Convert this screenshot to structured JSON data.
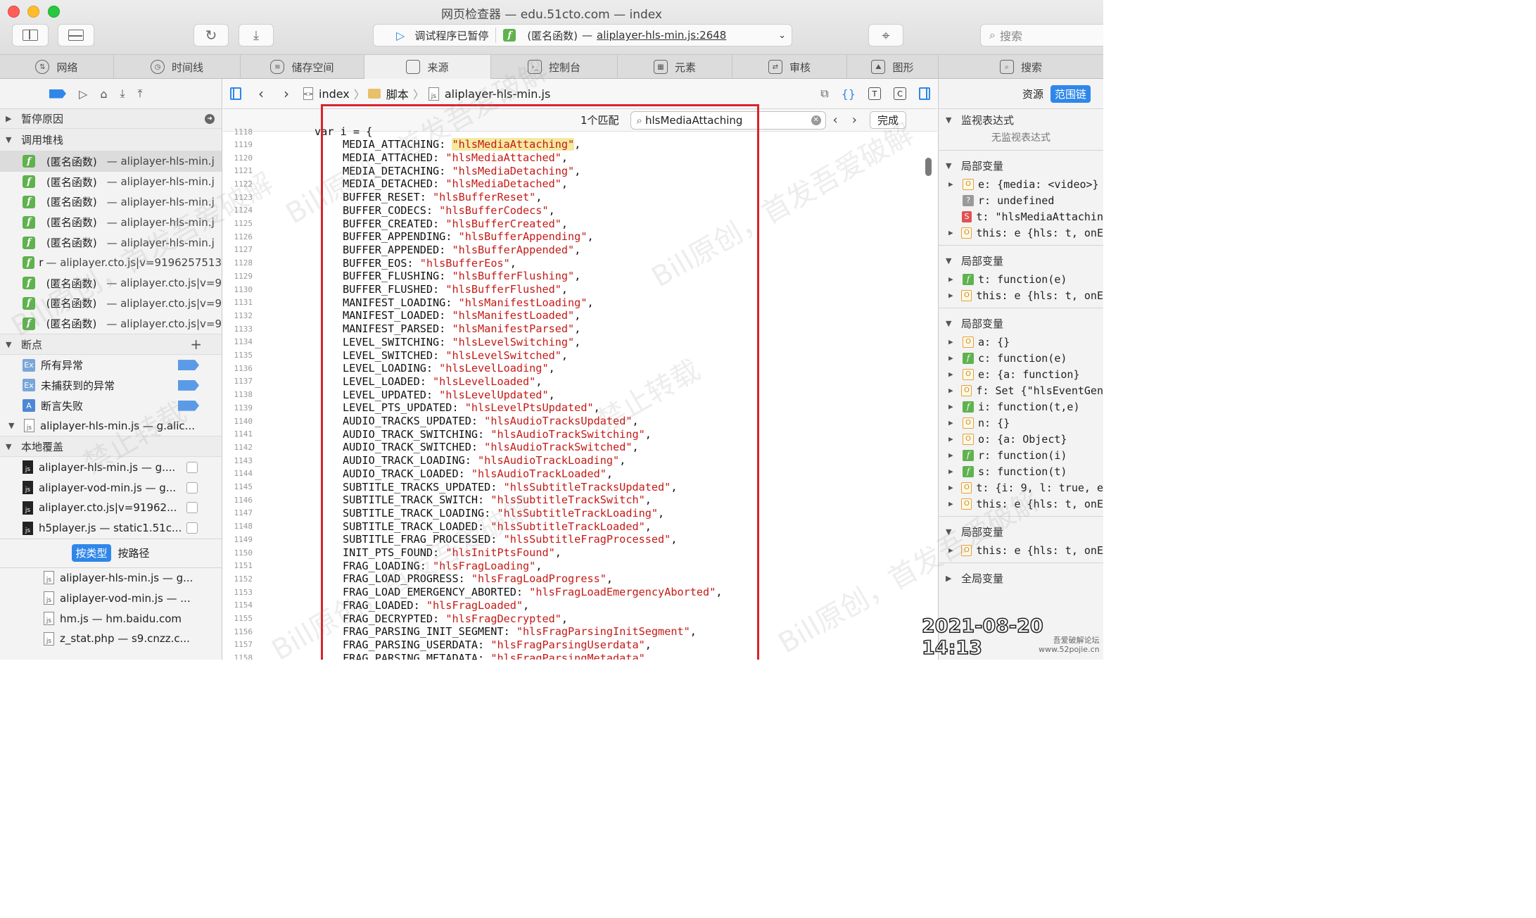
{
  "window": {
    "title": "网页检查器 — edu.51cto.com — index"
  },
  "status": {
    "paused_label": "调试程序已暂停",
    "function_label": "(匿名函数)",
    "location": "aliplayer-hls-min.js:2648"
  },
  "search": {
    "placeholder": "搜索"
  },
  "tabs": [
    {
      "label": "网络"
    },
    {
      "label": "时间线"
    },
    {
      "label": "储存空间"
    },
    {
      "label": "来源"
    },
    {
      "label": "控制台"
    },
    {
      "label": "元素"
    },
    {
      "label": "审核"
    },
    {
      "label": "图形"
    },
    {
      "label": "搜索"
    }
  ],
  "left": {
    "pause_reason": "暂停原因",
    "call_stack": "调用堆栈",
    "frames": [
      {
        "fn": "(匿名函数)",
        "loc": "— aliplayer-hls-min.j"
      },
      {
        "fn": "(匿名函数)",
        "loc": "— aliplayer-hls-min.j"
      },
      {
        "fn": "(匿名函数)",
        "loc": "— aliplayer-hls-min.j"
      },
      {
        "fn": "(匿名函数)",
        "loc": "— aliplayer-hls-min.j"
      },
      {
        "fn": "(匿名函数)",
        "loc": "— aliplayer-hls-min.j"
      },
      {
        "fn": "r",
        "loc": "— aliplayer.cto.js|v=9196257513"
      },
      {
        "fn": "(匿名函数)",
        "loc": "— aliplayer.cto.js|v=9"
      },
      {
        "fn": "(匿名函数)",
        "loc": "— aliplayer.cto.js|v=9"
      },
      {
        "fn": "(匿名函数)",
        "loc": "— aliplayer.cto.js|v=9"
      }
    ],
    "breakpoints": "断点",
    "bp_items": [
      {
        "badge": "Ex",
        "label": "所有异常"
      },
      {
        "badge": "Ex",
        "label": "未捕获到的异常"
      },
      {
        "badge": "A",
        "label": "断言失败"
      }
    ],
    "bp_file": "aliplayer-hls-min.js — g.alic...",
    "local_overrides": "本地覆盖",
    "overrides": [
      {
        "label": "aliplayer-hls-min.js — g...."
      },
      {
        "label": "aliplayer-vod-min.js — g..."
      },
      {
        "label": "aliplayer.cto.js|v=91962..."
      },
      {
        "label": "h5player.js — static1.51c..."
      }
    ],
    "type_tab_active": "按类型",
    "type_tab_other": "按路径",
    "files": [
      {
        "label": "aliplayer-hls-min.js — g..."
      },
      {
        "label": "aliplayer-vod-min.js — ..."
      },
      {
        "label": "hm.js — hm.baidu.com"
      },
      {
        "label": "z_stat.php — s9.cnzz.c..."
      }
    ]
  },
  "breadcrumb": {
    "root": "index",
    "folder": "脚本",
    "file": "aliplayer-hls-min.js"
  },
  "find": {
    "match_count": "1个匹配",
    "query": "hlsMediaAttaching",
    "done": "完成"
  },
  "code": {
    "first_line": "1118",
    "first_text": "var i = {",
    "lines": [
      {
        "n": "1119",
        "k": "MEDIA_ATTACHING: ",
        "v": "\"hlsMediaAttaching\"",
        "e": ","
      },
      {
        "n": "1120",
        "k": "MEDIA_ATTACHED: ",
        "v": "\"hlsMediaAttached\"",
        "e": ","
      },
      {
        "n": "1121",
        "k": "MEDIA_DETACHING: ",
        "v": "\"hlsMediaDetaching\"",
        "e": ","
      },
      {
        "n": "1122",
        "k": "MEDIA_DETACHED: ",
        "v": "\"hlsMediaDetached\"",
        "e": ","
      },
      {
        "n": "1123",
        "k": "BUFFER_RESET: ",
        "v": "\"hlsBufferReset\"",
        "e": ","
      },
      {
        "n": "1124",
        "k": "BUFFER_CODECS: ",
        "v": "\"hlsBufferCodecs\"",
        "e": ","
      },
      {
        "n": "1125",
        "k": "BUFFER_CREATED: ",
        "v": "\"hlsBufferCreated\"",
        "e": ","
      },
      {
        "n": "1126",
        "k": "BUFFER_APPENDING: ",
        "v": "\"hlsBufferAppending\"",
        "e": ","
      },
      {
        "n": "1127",
        "k": "BUFFER_APPENDED: ",
        "v": "\"hlsBufferAppended\"",
        "e": ","
      },
      {
        "n": "1128",
        "k": "BUFFER_EOS: ",
        "v": "\"hlsBufferEos\"",
        "e": ","
      },
      {
        "n": "1129",
        "k": "BUFFER_FLUSHING: ",
        "v": "\"hlsBufferFlushing\"",
        "e": ","
      },
      {
        "n": "1130",
        "k": "BUFFER_FLUSHED: ",
        "v": "\"hlsBufferFlushed\"",
        "e": ","
      },
      {
        "n": "1131",
        "k": "MANIFEST_LOADING: ",
        "v": "\"hlsManifestLoading\"",
        "e": ","
      },
      {
        "n": "1132",
        "k": "MANIFEST_LOADED: ",
        "v": "\"hlsManifestLoaded\"",
        "e": ","
      },
      {
        "n": "1133",
        "k": "MANIFEST_PARSED: ",
        "v": "\"hlsManifestParsed\"",
        "e": ","
      },
      {
        "n": "1134",
        "k": "LEVEL_SWITCHING: ",
        "v": "\"hlsLevelSwitching\"",
        "e": ","
      },
      {
        "n": "1135",
        "k": "LEVEL_SWITCHED: ",
        "v": "\"hlsLevelSwitched\"",
        "e": ","
      },
      {
        "n": "1136",
        "k": "LEVEL_LOADING: ",
        "v": "\"hlsLevelLoading\"",
        "e": ","
      },
      {
        "n": "1137",
        "k": "LEVEL_LOADED: ",
        "v": "\"hlsLevelLoaded\"",
        "e": ","
      },
      {
        "n": "1138",
        "k": "LEVEL_UPDATED: ",
        "v": "\"hlsLevelUpdated\"",
        "e": ","
      },
      {
        "n": "1139",
        "k": "LEVEL_PTS_UPDATED: ",
        "v": "\"hlsLevelPtsUpdated\"",
        "e": ","
      },
      {
        "n": "1140",
        "k": "AUDIO_TRACKS_UPDATED: ",
        "v": "\"hlsAudioTracksUpdated\"",
        "e": ","
      },
      {
        "n": "1141",
        "k": "AUDIO_TRACK_SWITCHING: ",
        "v": "\"hlsAudioTrackSwitching\"",
        "e": ","
      },
      {
        "n": "1142",
        "k": "AUDIO_TRACK_SWITCHED: ",
        "v": "\"hlsAudioTrackSwitched\"",
        "e": ","
      },
      {
        "n": "1143",
        "k": "AUDIO_TRACK_LOADING: ",
        "v": "\"hlsAudioTrackLoading\"",
        "e": ","
      },
      {
        "n": "1144",
        "k": "AUDIO_TRACK_LOADED: ",
        "v": "\"hlsAudioTrackLoaded\"",
        "e": ","
      },
      {
        "n": "1145",
        "k": "SUBTITLE_TRACKS_UPDATED: ",
        "v": "\"hlsSubtitleTracksUpdated\"",
        "e": ","
      },
      {
        "n": "1146",
        "k": "SUBTITLE_TRACK_SWITCH: ",
        "v": "\"hlsSubtitleTrackSwitch\"",
        "e": ","
      },
      {
        "n": "1147",
        "k": "SUBTITLE_TRACK_LOADING: ",
        "v": "\"hlsSubtitleTrackLoading\"",
        "e": ","
      },
      {
        "n": "1148",
        "k": "SUBTITLE_TRACK_LOADED: ",
        "v": "\"hlsSubtitleTrackLoaded\"",
        "e": ","
      },
      {
        "n": "1149",
        "k": "SUBTITLE_FRAG_PROCESSED: ",
        "v": "\"hlsSubtitleFragProcessed\"",
        "e": ","
      },
      {
        "n": "1150",
        "k": "INIT_PTS_FOUND: ",
        "v": "\"hlsInitPtsFound\"",
        "e": ","
      },
      {
        "n": "1151",
        "k": "FRAG_LOADING: ",
        "v": "\"hlsFragLoading\"",
        "e": ","
      },
      {
        "n": "1152",
        "k": "FRAG_LOAD_PROGRESS: ",
        "v": "\"hlsFragLoadProgress\"",
        "e": ","
      },
      {
        "n": "1153",
        "k": "FRAG_LOAD_EMERGENCY_ABORTED: ",
        "v": "\"hlsFragLoadEmergencyAborted\"",
        "e": ","
      },
      {
        "n": "1154",
        "k": "FRAG_LOADED: ",
        "v": "\"hlsFragLoaded\"",
        "e": ","
      },
      {
        "n": "1155",
        "k": "FRAG_DECRYPTED: ",
        "v": "\"hlsFragDecrypted\"",
        "e": ","
      },
      {
        "n": "1156",
        "k": "FRAG_PARSING_INIT_SEGMENT: ",
        "v": "\"hlsFragParsingInitSegment\"",
        "e": ","
      },
      {
        "n": "1157",
        "k": "FRAG_PARSING_USERDATA: ",
        "v": "\"hlsFragParsingUserdata\"",
        "e": ","
      },
      {
        "n": "1158",
        "k": "FRAG_PARSING_METADATA: ",
        "v": "\"hlsFragParsingMetadata\"",
        "e": ","
      }
    ]
  },
  "right": {
    "resources": "资源",
    "scope_chain": "范围链",
    "watch": "监视表达式",
    "no_watch": "无监视表达式",
    "scopes": [
      {
        "title": "局部变量",
        "rows": [
          {
            "b": "O",
            "t": "e: {media: <video>}"
          },
          {
            "b": "?",
            "t": "r: undefined"
          },
          {
            "b": "S",
            "t": "t: \"hlsMediaAttachin"
          },
          {
            "b": "O",
            "t": "this: e {hls: t, onE"
          }
        ]
      },
      {
        "title": "局部变量",
        "rows": [
          {
            "b": "f",
            "t": "t: function(e)"
          },
          {
            "b": "O",
            "t": "this: e {hls: t, onE"
          }
        ]
      },
      {
        "title": "局部变量",
        "rows": [
          {
            "b": "O",
            "t": "a: {}"
          },
          {
            "b": "f",
            "t": "c: function(e)"
          },
          {
            "b": "O",
            "t": "e: {a: function}"
          },
          {
            "b": "O",
            "t": "f: Set {\"hlsEventGen"
          },
          {
            "b": "f",
            "t": "i: function(t,e)"
          },
          {
            "b": "O",
            "t": "n: {}"
          },
          {
            "b": "O",
            "t": "o: {a: Object}"
          },
          {
            "b": "f",
            "t": "r: function(i)"
          },
          {
            "b": "f",
            "t": "s: function(t)"
          },
          {
            "b": "O",
            "t": "t: {i: 9, l: true, e"
          },
          {
            "b": "O",
            "t": "this: e {hls: t, onE"
          }
        ]
      },
      {
        "title": "局部变量",
        "rows": [
          {
            "b": "O",
            "t": "this: e {hls: t, onE"
          }
        ]
      }
    ],
    "global": "全局变量"
  },
  "overlay": {
    "timestamp": "2021-08-20 14:13",
    "site_line1": "吾爱破解论坛",
    "site_line2": "www.52pojie.cn",
    "wm1": "Bill原创，首发吾爱破解",
    "wm2": "禁止转载"
  },
  "colors": {
    "accent": "#2f87e9",
    "string": "#c41a16",
    "highlight_box": "#d9232b",
    "match": "#f5e9a0"
  }
}
